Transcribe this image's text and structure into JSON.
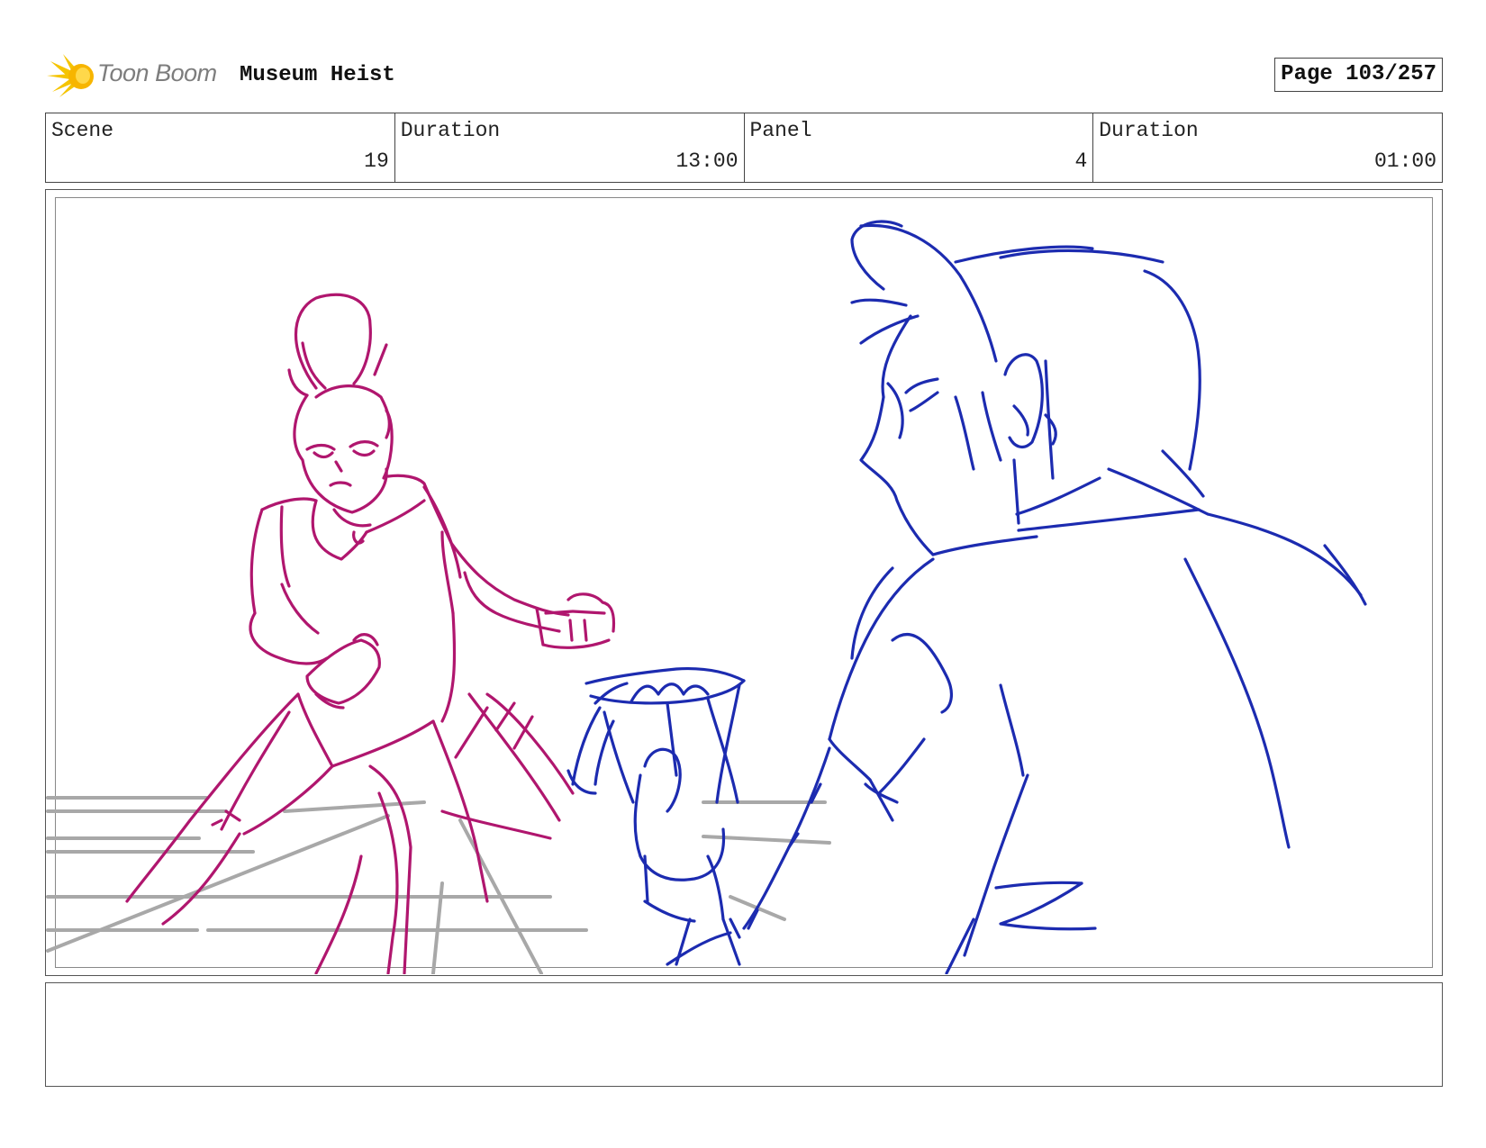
{
  "header": {
    "logo_text": "Toon Boom",
    "project_title": "Museum Heist",
    "page_label": "Page 103/257"
  },
  "info": [
    {
      "label": "Scene",
      "value": "19"
    },
    {
      "label": "Duration",
      "value": "13:00"
    },
    {
      "label": "Panel",
      "value": "4"
    },
    {
      "label": "Duration",
      "value": "01:00"
    }
  ],
  "colors": {
    "pink_character": "#b0166e",
    "blue_character": "#1c2bb0",
    "floor_grid": "#a8a8a8",
    "logo_star": "#f5c400"
  },
  "panel": {
    "notes": ""
  }
}
